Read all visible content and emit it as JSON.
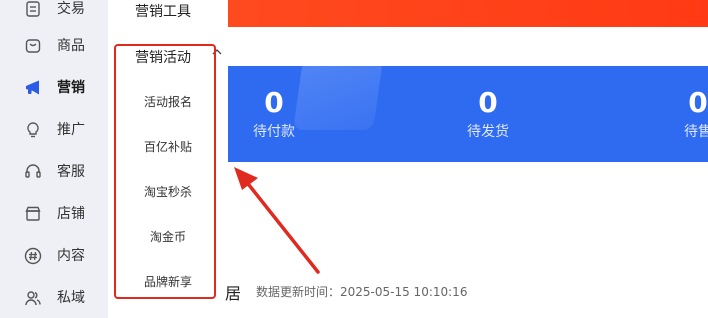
{
  "sidebar": {
    "items": [
      {
        "label": "交易",
        "icon": "receipt-icon"
      },
      {
        "label": "商品",
        "icon": "shopping-bag-icon"
      },
      {
        "label": "营销",
        "icon": "megaphone-icon"
      },
      {
        "label": "推广",
        "icon": "lightbulb-icon"
      },
      {
        "label": "客服",
        "icon": "headset-icon"
      },
      {
        "label": "店铺",
        "icon": "store-icon"
      },
      {
        "label": "内容",
        "icon": "hashtag-icon"
      },
      {
        "label": "私域",
        "icon": "users-icon"
      }
    ],
    "active": "营销"
  },
  "submenu": {
    "title": "营销工具",
    "group": "营销活动",
    "items": [
      "活动报名",
      "百亿补贴",
      "淘宝秒杀",
      "淘金币",
      "品牌新享"
    ]
  },
  "stats": [
    {
      "value": "0",
      "label": "待付款"
    },
    {
      "value": "0",
      "label": "待发货"
    },
    {
      "value": "0",
      "label": "待售"
    }
  ],
  "main": {
    "heading_fragment": "居",
    "update_text": "数据更新时间：2025-05-15 10:10:16"
  },
  "colors": {
    "sidebar_bg": "#eef0f5",
    "active_icon": "#2a5ce6",
    "highlight": "#e02a20",
    "banner": "#ff3a14",
    "stats_bg": "#2f6bf0"
  }
}
